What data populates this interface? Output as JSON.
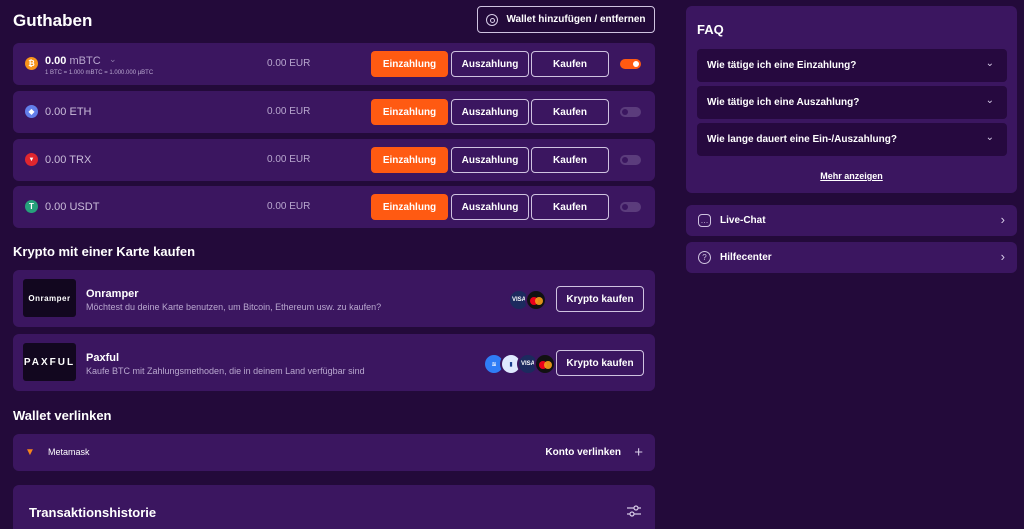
{
  "balance": {
    "title": "Guthaben",
    "wallet_button": "Wallet hinzufügen / entfernen",
    "coins": [
      {
        "amount": "0.00",
        "unit": "mBTC",
        "sub": "1 BTC = 1.000 mBTC = 1.000.000 µBTC",
        "fiat": "0.00 EUR",
        "icon": "bitcoin-icon",
        "color": "#f7931a",
        "symbol": "₿",
        "enabled": true
      },
      {
        "amount": "0.00",
        "unit": "ETH",
        "fiat": "0.00 EUR",
        "icon": "ethereum-icon",
        "color": "#627eea",
        "symbol": "◆",
        "enabled": false
      },
      {
        "amount": "0.00",
        "unit": "TRX",
        "fiat": "0.00 EUR",
        "icon": "tron-icon",
        "color": "#e0262e",
        "symbol": "▼",
        "enabled": false
      },
      {
        "amount": "0.00",
        "unit": "USDT",
        "fiat": "0.00 EUR",
        "icon": "tether-icon",
        "color": "#26a17b",
        "symbol": "T",
        "enabled": false
      }
    ],
    "deposit_label": "Einzahlung",
    "withdraw_label": "Auszahlung",
    "buy_label": "Kaufen"
  },
  "card_section": {
    "title": "Krypto mit einer Karte kaufen",
    "providers": [
      {
        "logo": "Onramper",
        "name": "Onramper",
        "desc": "Möchtest du deine Karte benutzen, um Bitcoin, Ethereum usw. zu kaufen?",
        "button": "Krypto kaufen"
      },
      {
        "logo": "PAXFUL",
        "name": "Paxful",
        "desc": "Kaufe BTC mit Zahlungsmethoden, die in deinem Land verfügbar sind",
        "button": "Krypto kaufen"
      }
    ],
    "visa_label": "VISA"
  },
  "wallet_link": {
    "title": "Wallet verlinken",
    "wallet_name": "Metamask",
    "action": "Konto verlinken"
  },
  "transactions": {
    "title": "Transaktionshistorie"
  },
  "faq": {
    "title": "FAQ",
    "items": [
      "Wie tätige ich eine Einzahlung?",
      "Wie tätige ich eine Auszahlung?",
      "Wie lange dauert eine Ein-/Auszahlung?"
    ],
    "more": "Mehr anzeigen"
  },
  "help": {
    "live_chat": "Live-Chat",
    "help_center": "Hilfecenter"
  },
  "colors": {
    "background": "#230a3a",
    "panel": "#3b1660",
    "accent": "#ff5a12"
  }
}
